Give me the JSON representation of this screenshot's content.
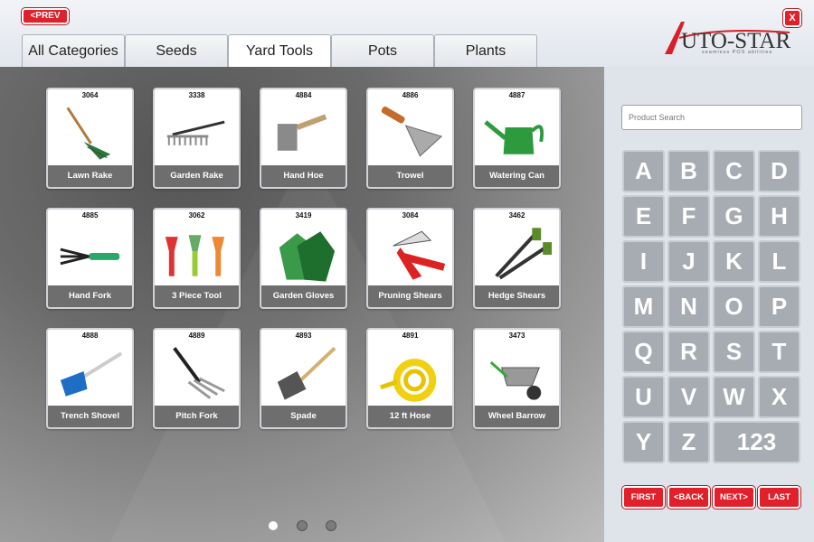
{
  "header": {
    "prev_label": "<PREV",
    "close_label": "X",
    "logo_name": "AUTO-STAR",
    "logo_tagline": "seamless POS abilities"
  },
  "tabs": [
    {
      "label": "All Categories"
    },
    {
      "label": "Seeds"
    },
    {
      "label": "Yard Tools",
      "active": true
    },
    {
      "label": "Pots"
    },
    {
      "label": "Plants"
    }
  ],
  "products": [
    {
      "code": "3064",
      "name": "Lawn Rake",
      "icon": "lawn-rake-icon"
    },
    {
      "code": "3338",
      "name": "Garden Rake",
      "icon": "garden-rake-icon"
    },
    {
      "code": "4884",
      "name": "Hand Hoe",
      "icon": "hand-hoe-icon"
    },
    {
      "code": "4886",
      "name": "Trowel",
      "icon": "trowel-icon"
    },
    {
      "code": "4887",
      "name": "Watering Can",
      "icon": "watering-can-icon"
    },
    {
      "code": "4885",
      "name": "Hand Fork",
      "icon": "hand-fork-icon"
    },
    {
      "code": "3062",
      "name": "3 Piece Tool",
      "icon": "three-piece-tool-icon"
    },
    {
      "code": "3419",
      "name": "Garden Gloves",
      "icon": "garden-gloves-icon"
    },
    {
      "code": "3084",
      "name": "Pruning Shears",
      "icon": "pruning-shears-icon"
    },
    {
      "code": "3462",
      "name": "Hedge Shears",
      "icon": "hedge-shears-icon"
    },
    {
      "code": "4888",
      "name": "Trench Shovel",
      "icon": "trench-shovel-icon"
    },
    {
      "code": "4889",
      "name": "Pitch Fork",
      "icon": "pitch-fork-icon"
    },
    {
      "code": "4893",
      "name": "Spade",
      "icon": "spade-icon"
    },
    {
      "code": "4891",
      "name": "12 ft Hose",
      "icon": "hose-icon"
    },
    {
      "code": "3473",
      "name": "Wheel Barrow",
      "icon": "wheel-barrow-icon"
    }
  ],
  "pagination": {
    "pages": 3,
    "current": 1
  },
  "search": {
    "placeholder": "Product Search"
  },
  "keypad": [
    "A",
    "B",
    "C",
    "D",
    "E",
    "F",
    "G",
    "H",
    "I",
    "J",
    "K",
    "L",
    "M",
    "N",
    "O",
    "P",
    "Q",
    "R",
    "S",
    "T",
    "U",
    "V",
    "W",
    "X",
    "Y",
    "Z",
    "123"
  ],
  "nav": {
    "first": "FIRST",
    "back": "<BACK",
    "next": "NEXT>",
    "last": "LAST"
  },
  "colors": {
    "accent": "#e0202a",
    "key": "#a7acb2",
    "label_bar": "#6e6e6e"
  }
}
